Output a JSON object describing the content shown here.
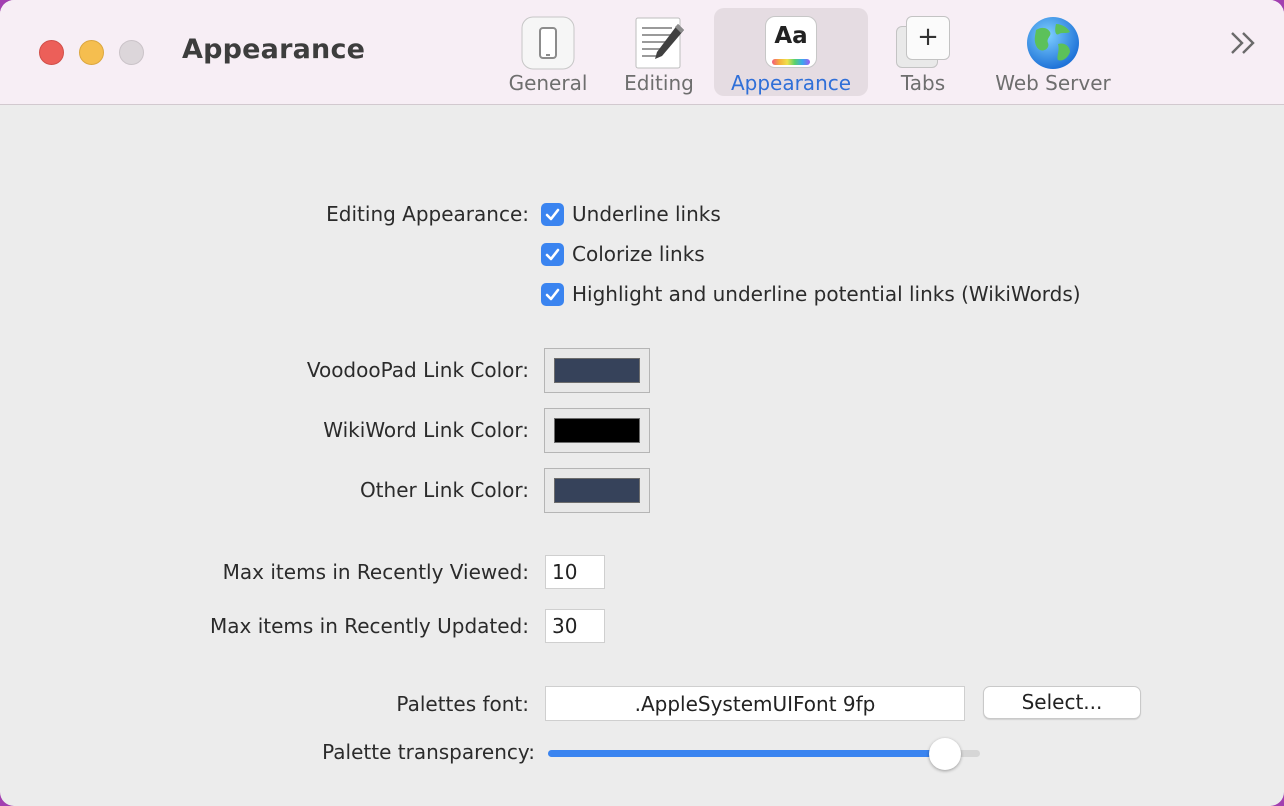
{
  "window": {
    "title": "Appearance",
    "controls": [
      "close",
      "minimize",
      "zoom"
    ]
  },
  "toolbar": {
    "tabs": [
      {
        "label": "General",
        "icon": "phone-icon"
      },
      {
        "label": "Editing",
        "icon": "notepad-pencil-icon"
      },
      {
        "label": "Appearance",
        "icon": "text-aa-icon",
        "icon_text": "Aa",
        "active": true
      },
      {
        "label": "Tabs",
        "icon": "tabs-plus-icon",
        "icon_text": "+"
      },
      {
        "label": "Web Server",
        "icon": "globe-icon"
      }
    ],
    "overflow_icon": "chevron-double-right-icon"
  },
  "editing_appearance": {
    "label": "Editing Appearance:",
    "options": [
      {
        "label": "Underline links",
        "checked": true
      },
      {
        "label": "Colorize links",
        "checked": true
      },
      {
        "label": "Highlight and underline potential links (WikiWords)",
        "checked": true
      }
    ]
  },
  "link_colors": [
    {
      "label": "VoodooPad Link Color:",
      "color": "#36425a"
    },
    {
      "label": "WikiWord Link Color:",
      "color": "#000000"
    },
    {
      "label": "Other Link Color:",
      "color": "#36425a"
    }
  ],
  "recent": {
    "viewed_label": "Max items in Recently Viewed:",
    "viewed_value": "10",
    "updated_label": "Max items in Recently Updated:",
    "updated_value": "30"
  },
  "palettes": {
    "font_label": "Palettes font:",
    "font_value": ".AppleSystemUIFont 9fp",
    "select_label": "Select...",
    "transparency_label": "Palette transparency:",
    "transparency_fraction": 0.92
  },
  "colors": {
    "accent": "#3a84f0",
    "active_tab_label": "#2f6fd8"
  }
}
